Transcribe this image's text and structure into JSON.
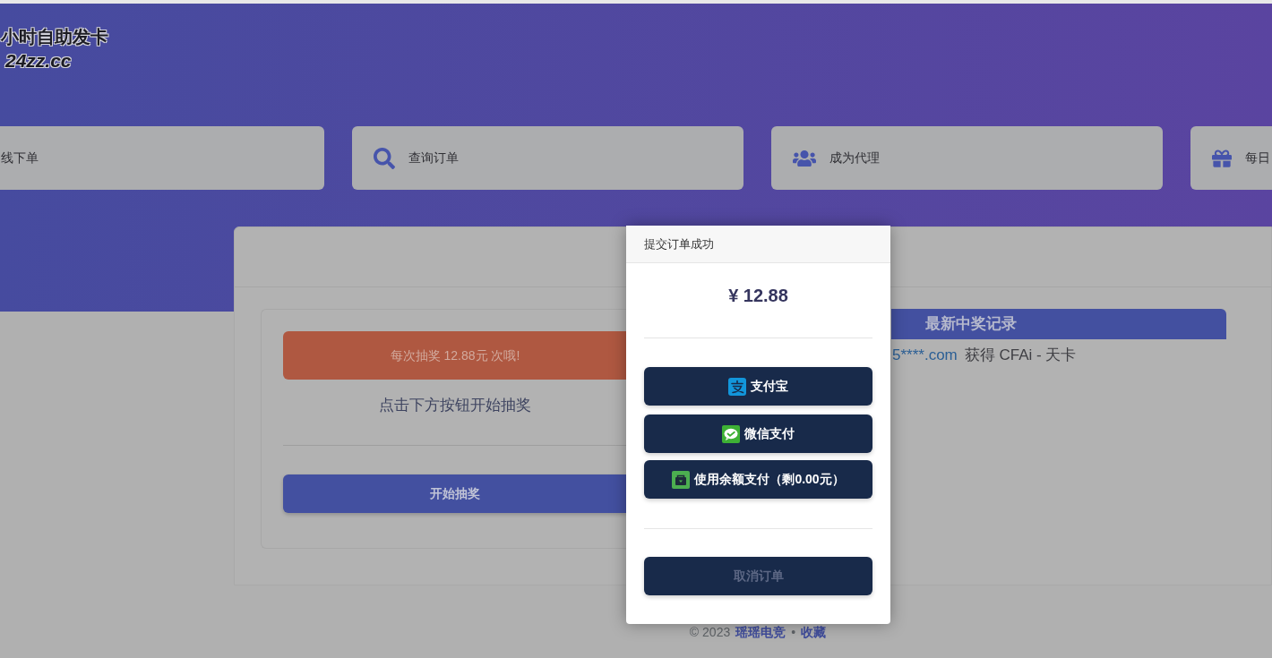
{
  "logo": {
    "title": "小时自助发卡",
    "domain": "24zz.cc"
  },
  "nav_cards": [
    {
      "kind": "plain",
      "label": "线下单"
    },
    {
      "kind": "search",
      "label": "查询订单"
    },
    {
      "kind": "group",
      "label": "成为代理"
    },
    {
      "kind": "gift",
      "label": "每日"
    }
  ],
  "lottery": {
    "notice": "每次抽奖 12.88元 次哦!",
    "hint": "点击下方按钮开始抽奖",
    "start_button": "开始抽奖"
  },
  "winners": {
    "title": "最新中奖记录",
    "records": [
      {
        "user": "5****.com",
        "prize": "获得 CFAi - 天卡"
      }
    ]
  },
  "dialog": {
    "title": "提交订单成功",
    "amount": "¥ 12.88",
    "payment_options": [
      {
        "kind": "alipay",
        "label": "支付宝"
      },
      {
        "kind": "wechat",
        "label": "微信支付"
      },
      {
        "kind": "balance",
        "label": "使用余额支付（剩0.00元）"
      }
    ],
    "cancel_button": "取消订单"
  },
  "footer": {
    "copyright": "© 2023",
    "links": [
      {
        "label": "瑶瑶电竞"
      },
      {
        "label": "收藏"
      }
    ],
    "separator": "•"
  }
}
